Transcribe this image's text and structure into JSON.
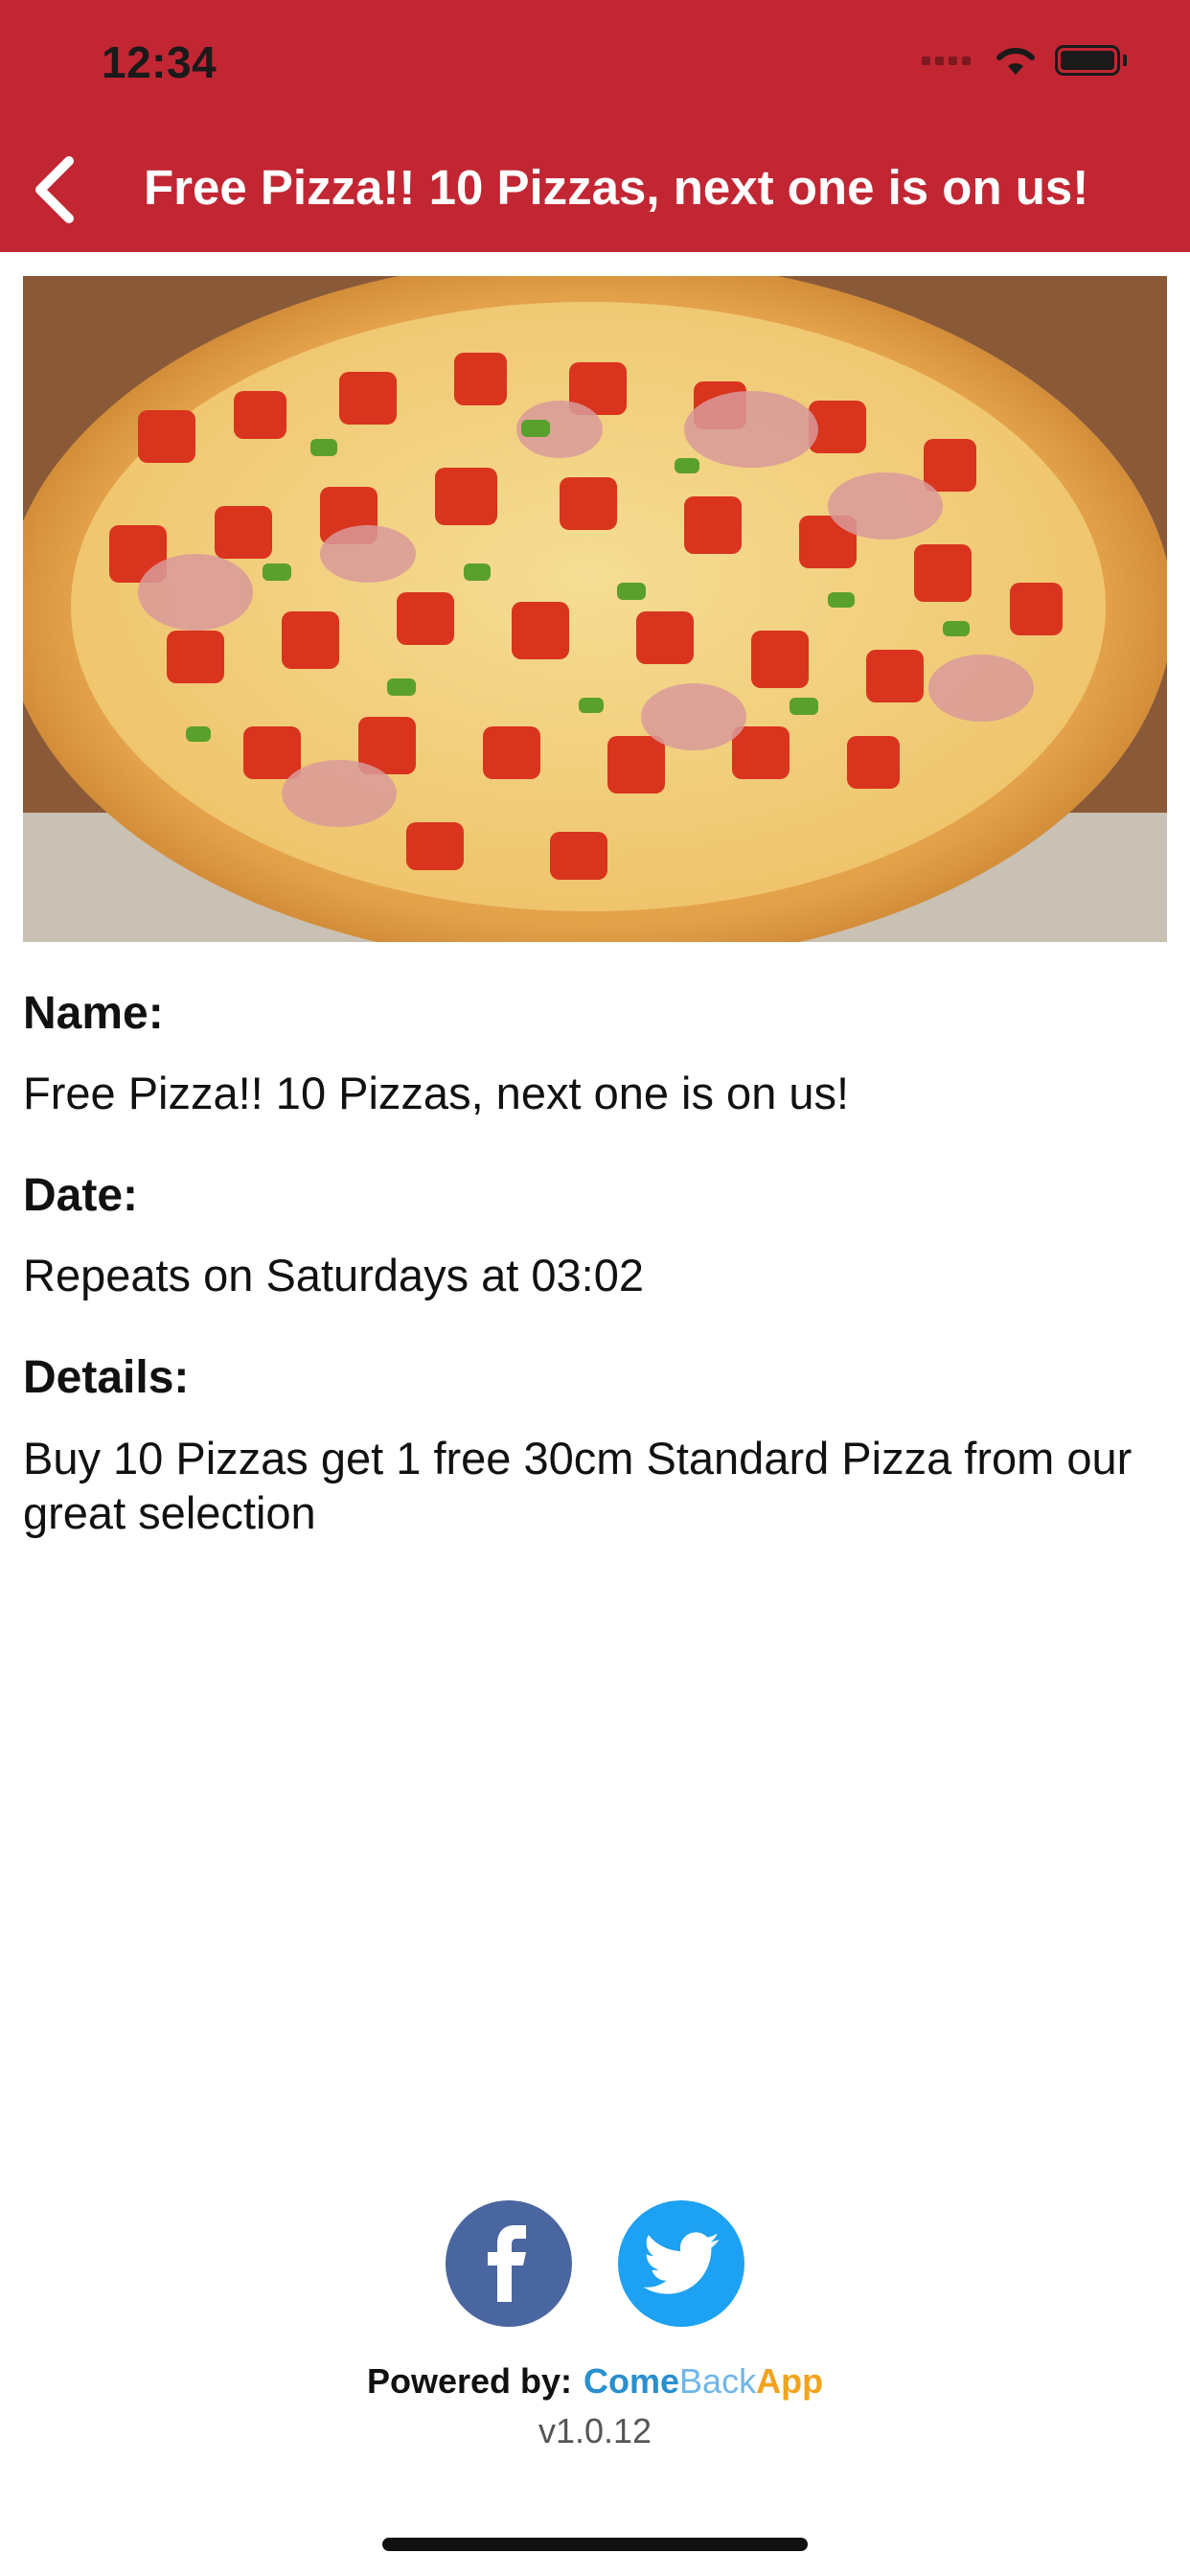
{
  "status_bar": {
    "time": "12:34"
  },
  "nav": {
    "title": "Free Pizza!! 10 Pizzas, next one is on us!"
  },
  "details": {
    "name_label": "Name:",
    "name_value": "Free Pizza!! 10 Pizzas, next one is on us!",
    "date_label": "Date:",
    "date_value": "Repeats on Saturdays at 03:02",
    "details_label": "Details:",
    "details_value": "Buy 10 Pizzas get 1 free 30cm Standard Pizza from our great selection"
  },
  "social": {
    "icons": [
      "facebook-icon",
      "twitter-icon"
    ]
  },
  "footer": {
    "powered_label": "Powered by:",
    "brand_come": "Come",
    "brand_back": "Back",
    "brand_app": "App",
    "version": "v1.0.12"
  },
  "colors": {
    "header": "#c22633",
    "facebook": "#4a66a0",
    "twitter": "#1da1f2",
    "brand_come": "#2a8fcf",
    "brand_back": "#6fb6e8",
    "brand_app": "#f2a31b"
  }
}
